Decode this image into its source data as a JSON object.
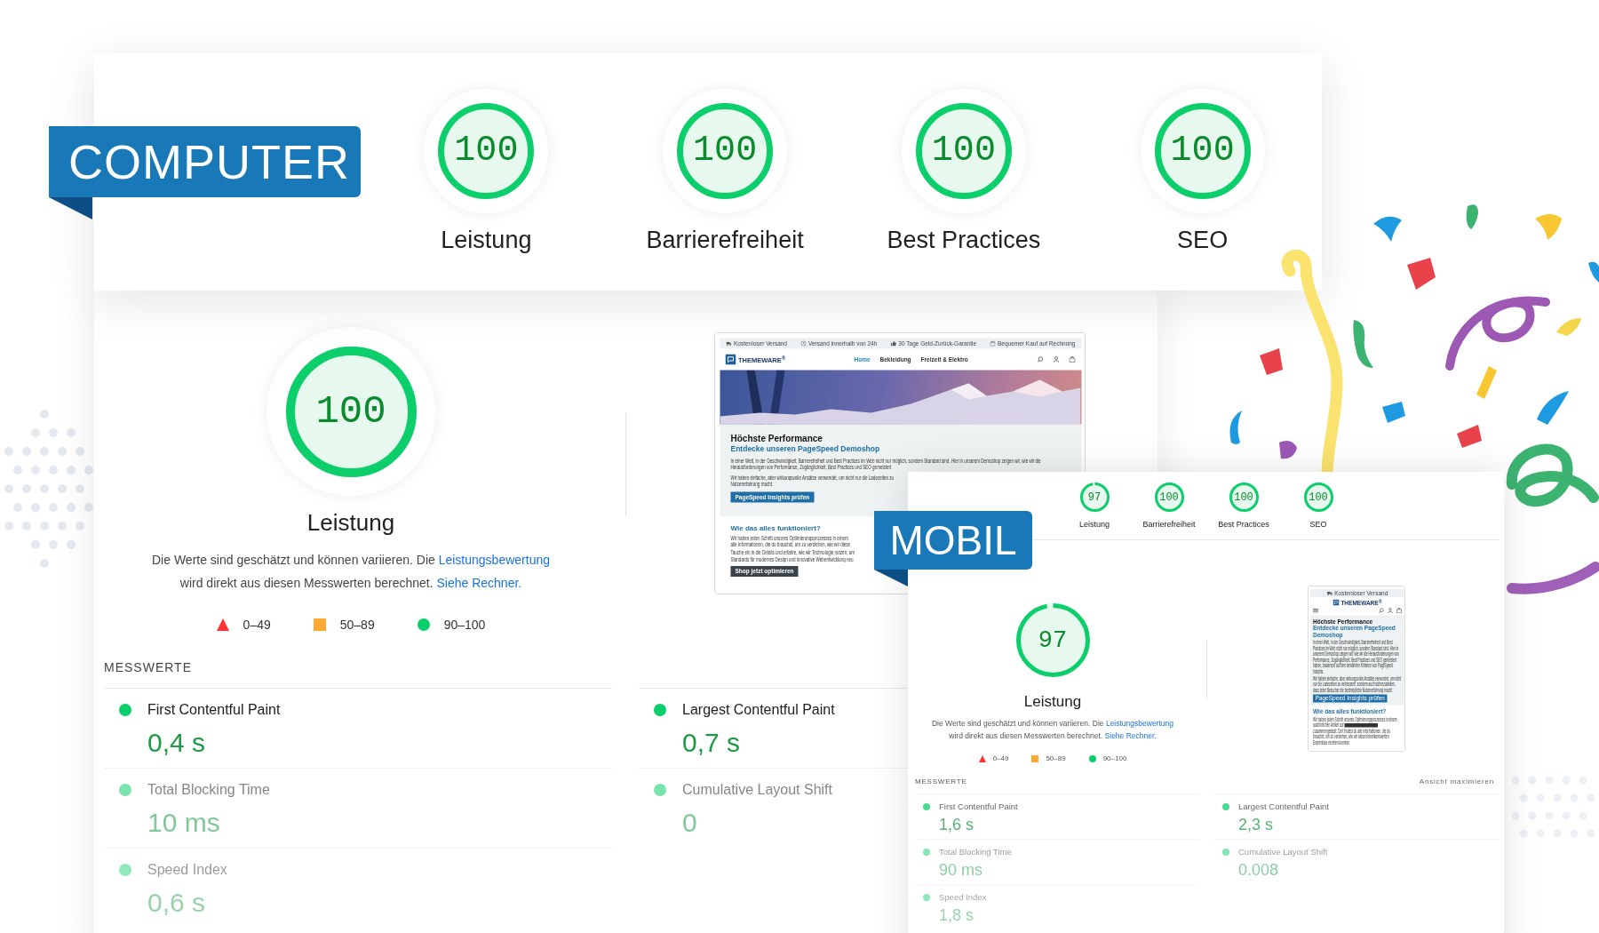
{
  "computer": {
    "badge": "COMPUTER",
    "categories": [
      {
        "score": "100",
        "label": "Leistung",
        "level": 1
      },
      {
        "score": "100",
        "label": "Barrierefreiheit",
        "level": 1
      },
      {
        "score": "100",
        "label": "Best Practices",
        "level": 1
      },
      {
        "score": "100",
        "label": "SEO",
        "level": 1
      }
    ],
    "performance": {
      "score": "100",
      "level": 1,
      "label": "Leistung",
      "description": [
        {
          "kind": "text",
          "text": "Die Werte sind geschätzt und können variieren. Die "
        },
        {
          "kind": "link",
          "text": "Leistungsbewertung"
        },
        {
          "kind": "text",
          "text": " wird direkt aus diesen Messwerten berechnet. "
        },
        {
          "kind": "link",
          "text": "Siehe Rechner."
        }
      ],
      "legend": [
        {
          "kind": "triangle",
          "label": "0–49",
          "color": "#ff3333"
        },
        {
          "kind": "square",
          "label": "50–89",
          "color": "#ffa933"
        },
        {
          "kind": "circle",
          "label": "90–100",
          "color": "#0cce6b"
        }
      ]
    },
    "preview": {
      "topbar": [
        "Kostenloser Versand",
        "Versand innerhalb von 24h",
        "30 Tage Geld-Zurück-Garantie",
        "Bequemer Kauf auf Rechnung"
      ],
      "logo": "THEMEWARE$^{®}$",
      "nav": [
        {
          "label": "Home",
          "selected": true
        },
        {
          "label": "Bekleidung",
          "selected": false
        },
        {
          "label": "Freizeit & Elektro",
          "selected": false
        }
      ],
      "heading": "Höchste Performance",
      "subheading": "Entdecke unseren PageSpeed Demoshop",
      "intro": "In einer Welt, in der Geschwindigkeit, Barrierefreiheit und Best Practices im Web nicht nur möglich, sondern Standard sind. Hier in unserem Demoshop zeigen wir, wie wir die Herausforderungen von Performance, Zugänglichkeit, Best Practices und SEO gemeistert",
      "intro_lines": [
        "Wir haben einfache, aber wirkungsvolle Ansätze verwendet, um nicht nur die Ladezeiten zu",
        "Nutzererfahrung macht."
      ],
      "primary_button": "PageSpeed Insights prüfen",
      "section_title": "Wie das alles funktioniert?",
      "section_lines": [
        "Wir haben jeden Schritt unseres Optimierungsprozesses in einem",
        "alle Informationen, die du brauchst, um zu verstehen, wie wir diese",
        "Tauche ein in die Details und erfahre, wie wir Technologie nutzen, um",
        "Standards für modernes Design und innovative Webentwicklung neu"
      ],
      "secondary_button": "Shop jetzt optimieren"
    },
    "metrics_heading": "MESSWERTE",
    "metrics": [
      {
        "name": "First Contentful Paint",
        "value": "0,4 s",
        "passed": true
      },
      {
        "name": "Largest Contentful Paint",
        "value": "0,7 s",
        "passed": true
      },
      {
        "name": "Total Blocking Time",
        "value": "10 ms",
        "passed": true
      },
      {
        "name": "Cumulative Layout Shift",
        "value": "0",
        "passed": true
      },
      {
        "name": "Speed Index",
        "value": "0,6 s",
        "passed": true
      }
    ]
  },
  "mobile": {
    "badge": "MOBIL",
    "categories": [
      {
        "score": "97",
        "label": "Leistung",
        "level": 0.97
      },
      {
        "score": "100",
        "label": "Barrierefreiheit",
        "level": 1
      },
      {
        "score": "100",
        "label": "Best Practices",
        "level": 1
      },
      {
        "score": "100",
        "label": "SEO",
        "level": 1
      }
    ],
    "performance": {
      "score": "97",
      "level": 0.97,
      "label": "Leistung",
      "description": [
        {
          "kind": "text",
          "text": "Die Werte sind geschätzt und können variieren. Die "
        },
        {
          "kind": "link",
          "text": "Leistungsbewertung"
        },
        {
          "kind": "text",
          "text": " wird direkt aus diesen Messwerten berechnet. "
        },
        {
          "kind": "link",
          "text": "Siehe Rechner."
        }
      ],
      "legend": [
        {
          "kind": "triangle",
          "label": "0–49",
          "color": "#ff3333"
        },
        {
          "kind": "square",
          "label": "50–89",
          "color": "#ffa933"
        },
        {
          "kind": "circle",
          "label": "90–100",
          "color": "#0cce6b"
        }
      ]
    },
    "preview": {
      "topbar": [
        "Kostenloser Versand"
      ],
      "logo": "THEMEWARE$^{®}$",
      "heading": "Höchste Performance",
      "subheading": "Entdecke unseren PageSpeed Demoshop",
      "paragraphs": [
        "In einer Welt, in der Geschwindigkeit, Barrierefreiheit und Best Practices im Web nicht nur möglich, sondern Standard sind. Hier in unserem Demoshop zeigen wir, wie wir die Herausforderungen von Performance, Zugänglichkeit, Best Practices und SEO gemeistert haben, basierend auf den bewährten Kriterien von PageSpeed Insights.",
        "Wir haben einfache, aber wirkungsvolle Ansätze verwendet, um nicht nur die Ladezeiten zu verbessern, sondern auch sicherzustellen, dass jeder Besucher die bestmögliche Nutzererfahrung macht."
      ],
      "primary_button": "PageSpeed Insights prüfen",
      "section_title": "Wie das alles funktioniert?",
      "section_text": [
        {
          "kind": "text",
          "text": "Wir haben jeden Schritt unseres Optimierungsprozesses in einem ausführlichen Artikel auf "
        },
        {
          "kind": "obscured"
        },
        {
          "kind": "text",
          "text": " zusammengefasst. Dort findest du alle Informationen, die du brauchst, um zu verstehen, wie wir diese bemerkenswerten Ergebnisse erzielen konnten."
        }
      ]
    },
    "metrics_heading": "MESSWERTE",
    "expand_link": "Ansicht maximieren",
    "metrics": [
      {
        "name": "First Contentful Paint",
        "value": "1,6 s",
        "passed": true
      },
      {
        "name": "Largest Contentful Paint",
        "value": "2,3 s",
        "passed": true
      },
      {
        "name": "Total Blocking Time",
        "value": "90 ms",
        "passed": true
      },
      {
        "name": "Cumulative Layout Shift",
        "value": "0.008",
        "passed": true
      },
      {
        "name": "Speed Index",
        "value": "1,8 s",
        "passed": true
      }
    ]
  }
}
